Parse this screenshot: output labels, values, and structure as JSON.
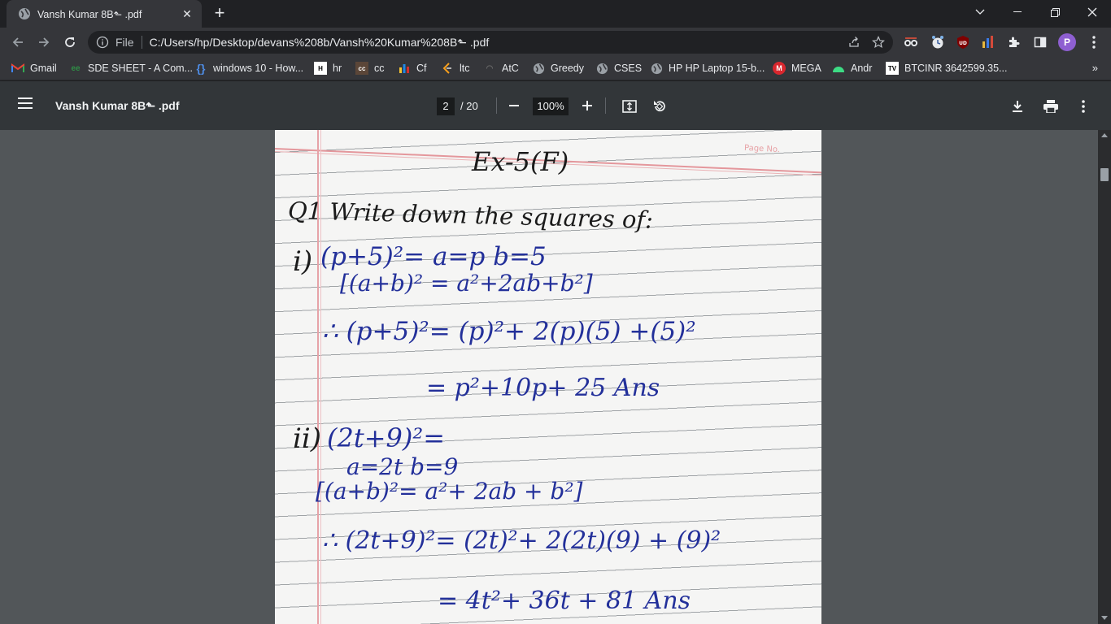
{
  "browser": {
    "tab_title": "Vansh Kumar 8B⬑ .pdf",
    "new_tab": "+",
    "url_scheme_label": "File",
    "url": "C:/Users/hp/Desktop/devans%208b/Vansh%20Kumar%208B⬑ .pdf",
    "profile_initial": "P",
    "bookmarks_more": "»"
  },
  "bookmarks": [
    {
      "label": "Gmail",
      "icon": "gmail-icon"
    },
    {
      "label": "SDE SHEET - A Com...",
      "icon": "gfg-icon"
    },
    {
      "label": "windows 10 - How...",
      "icon": "superuser-icon"
    },
    {
      "label": "hr",
      "icon": "hackerrank-icon"
    },
    {
      "label": "cc",
      "icon": "codechef-icon"
    },
    {
      "label": "Cf",
      "icon": "codeforces-icon"
    },
    {
      "label": "ltc",
      "icon": "leetcode-icon"
    },
    {
      "label": "AtC",
      "icon": "atcoder-icon"
    },
    {
      "label": "Greedy",
      "icon": "globe-icon"
    },
    {
      "label": "CSES",
      "icon": "globe-icon"
    },
    {
      "label": "HP HP Laptop 15-b...",
      "icon": "globe-icon"
    },
    {
      "label": "MEGA",
      "icon": "mega-icon"
    },
    {
      "label": "Andr",
      "icon": "android-icon"
    },
    {
      "label": "BTCINR 3642599.35...",
      "icon": "tradingview-icon"
    }
  ],
  "pdf": {
    "title": "Vansh Kumar 8B⬑ .pdf",
    "current_page": "2",
    "total_pages": "/ 20",
    "zoom": "100%"
  },
  "page_content": {
    "page_no_label": "Page No.",
    "heading": "Ex-5(F)",
    "question": "Q1 Write down the squares of:",
    "part1_label": "i)",
    "part1_given": "(p+5)²= a=p  b=5",
    "part1_formula": "[(a+b)² = a²+2ab+b²]",
    "part1_step": "∴ (p+5)²= (p)²+ 2(p)(5) +(5)²",
    "part1_answer": "= p²+10p+ 25 Ans",
    "part2_label": "ii)",
    "part2_expr": "(2t+9)²=",
    "part2_given": "a=2t    b=9",
    "part2_formula": "[(a+b)²= a²+ 2ab + b²]",
    "part2_step": "∴ (2t+9)²= (2t)²+ 2(2t)(9) + (9)²",
    "part2_answer": "= 4t²+ 36t + 81 Ans"
  }
}
